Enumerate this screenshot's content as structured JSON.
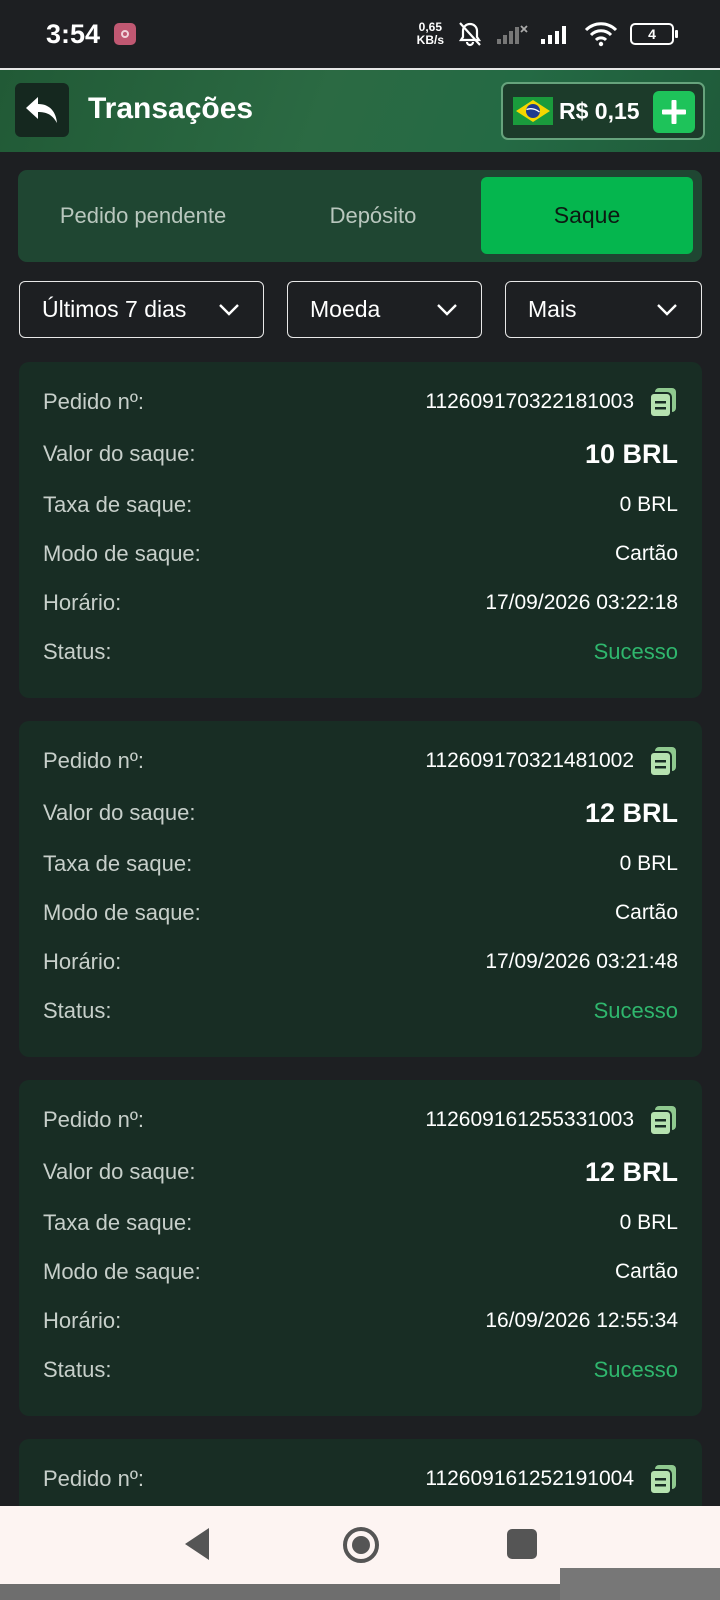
{
  "status_bar": {
    "time": "3:54",
    "speed_value": "0,65",
    "speed_unit": "KB/s",
    "battery": "4"
  },
  "header": {
    "title": "Transações",
    "balance": "R$ 0,15"
  },
  "tabs": [
    {
      "label": "Pedido pendente",
      "active": false
    },
    {
      "label": "Depósito",
      "active": false
    },
    {
      "label": "Saque",
      "active": true
    }
  ],
  "filters": {
    "period": "Últimos 7 dias",
    "currency": "Moeda",
    "more": "Mais"
  },
  "labels": {
    "order": "Pedido nº:",
    "amount": "Valor do saque:",
    "fee": "Taxa de saque:",
    "mode": "Modo de saque:",
    "time": "Horário:",
    "status": "Status:"
  },
  "transactions": [
    {
      "order": "112609170322181003",
      "amount": "10 BRL",
      "fee": "0 BRL",
      "mode": "Cartão",
      "time": "17/09/2026 03:22:18",
      "status": "Sucesso"
    },
    {
      "order": "112609170321481002",
      "amount": "12 BRL",
      "fee": "0 BRL",
      "mode": "Cartão",
      "time": "17/09/2026 03:21:48",
      "status": "Sucesso"
    },
    {
      "order": "112609161255331003",
      "amount": "12 BRL",
      "fee": "0 BRL",
      "mode": "Cartão",
      "time": "16/09/2026 12:55:34",
      "status": "Sucesso"
    },
    {
      "order": "112609161252191004"
    }
  ],
  "colors": {
    "accent": "#05b64e",
    "success": "#2fb66d",
    "card": "#182d24"
  }
}
